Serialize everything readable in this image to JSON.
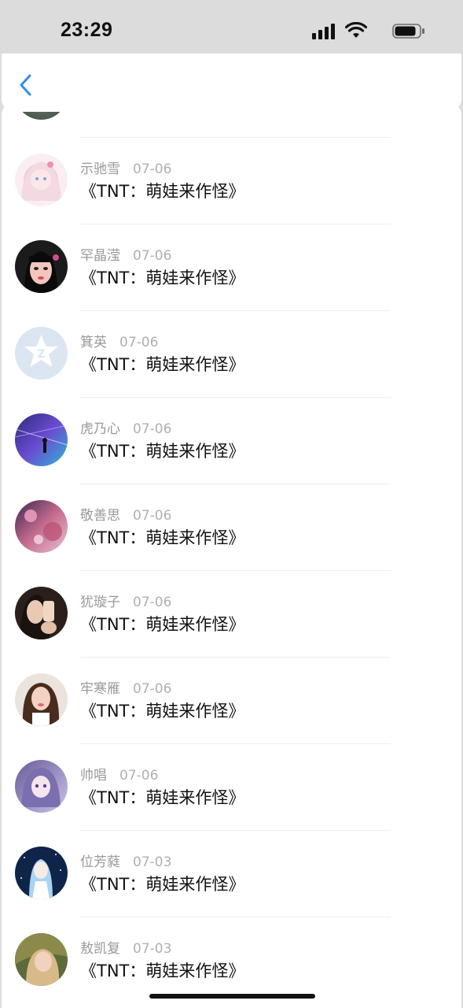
{
  "status_bar": {
    "time": "23:29"
  },
  "header": {
    "back_icon": "chevron-left-icon",
    "accent_color": "#2f8ef0"
  },
  "rows": [
    {
      "name": "示驰雪",
      "date": "07-06",
      "title": "《TNT：萌娃来作怪》"
    },
    {
      "name": "罕晶滢",
      "date": "07-06",
      "title": "《TNT：萌娃来作怪》"
    },
    {
      "name": "箕英",
      "date": "07-06",
      "title": "《TNT：萌娃来作怪》"
    },
    {
      "name": "虎乃心",
      "date": "07-06",
      "title": "《TNT：萌娃来作怪》"
    },
    {
      "name": "敬善思",
      "date": "07-06",
      "title": "《TNT：萌娃来作怪》"
    },
    {
      "name": "犹璇子",
      "date": "07-06",
      "title": "《TNT：萌娃来作怪》"
    },
    {
      "name": "牢寒雁",
      "date": "07-06",
      "title": "《TNT：萌娃来作怪》"
    },
    {
      "name": "帅唱",
      "date": "07-06",
      "title": "《TNT：萌娃来作怪》"
    },
    {
      "name": "位芳蕤",
      "date": "07-03",
      "title": "《TNT：萌娃来作怪》"
    },
    {
      "name": "敖凯复",
      "date": "07-03",
      "title": "《TNT：萌娃来作怪》"
    }
  ]
}
